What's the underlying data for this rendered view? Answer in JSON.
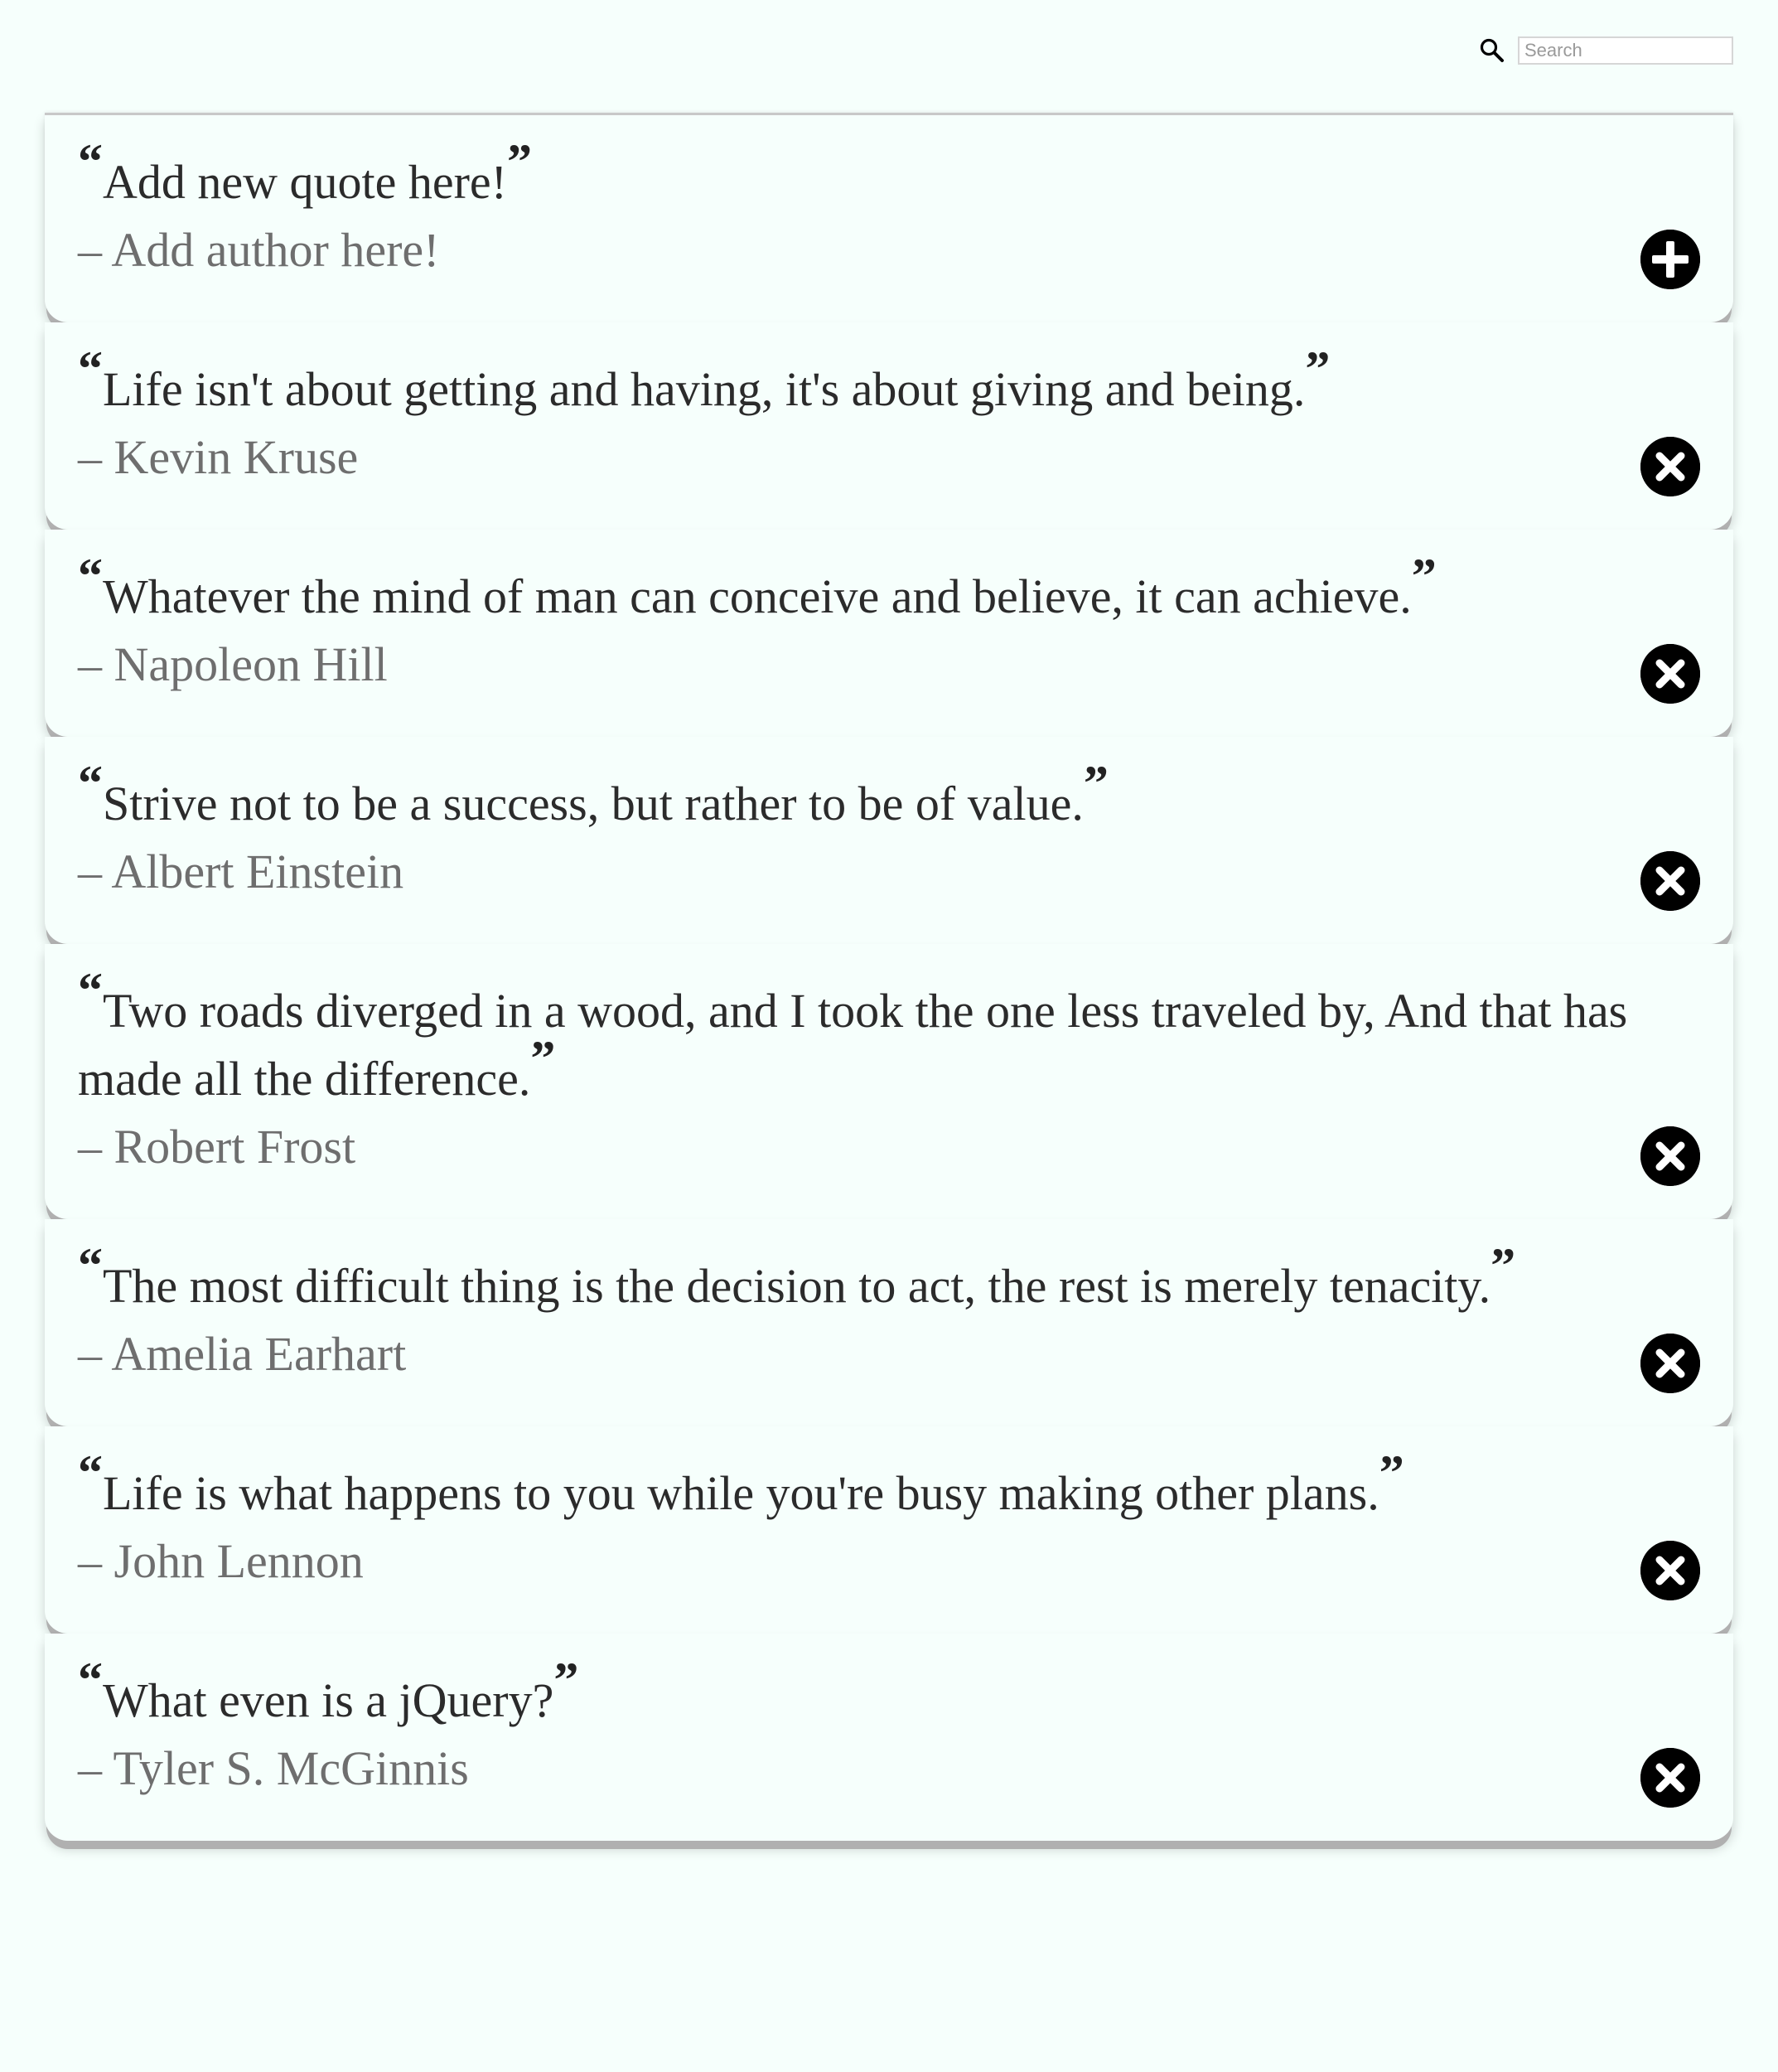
{
  "search": {
    "placeholder": "Search",
    "value": ""
  },
  "new_quote": {
    "quote_placeholder": "Add new quote here!",
    "author_placeholder": "Add author here!",
    "dash": "–",
    "action_icon": "plus-circle-icon"
  },
  "open_mark": "“",
  "close_mark": "”",
  "quotes": [
    {
      "text": "Life isn't about getting and having, it's about giving and being.",
      "author": "Kevin Kruse"
    },
    {
      "text": "Whatever the mind of man can conceive and believe, it can achieve.",
      "author": "Napoleon Hill"
    },
    {
      "text": "Strive not to be a success, but rather to be of value.",
      "author": "Albert Einstein"
    },
    {
      "text": "Two roads diverged in a wood, and I took the one less traveled by, And that has made all the difference.",
      "author": "Robert Frost"
    },
    {
      "text": "The most difficult thing is the decision to act, the rest is merely tenacity.",
      "author": "Amelia Earhart"
    },
    {
      "text": "Life is what happens to you while you're busy making other plans.",
      "author": "John Lennon"
    },
    {
      "text": "What even is a jQuery?",
      "author": "Tyler S. McGinnis"
    }
  ],
  "delete_icon": "close-circle-icon",
  "colors": {
    "background": "#f6fffc",
    "quote_text": "#2b2b2b",
    "author_text": "#6e6e6e",
    "button": "#000000",
    "shadow": "#b0b0b0"
  }
}
